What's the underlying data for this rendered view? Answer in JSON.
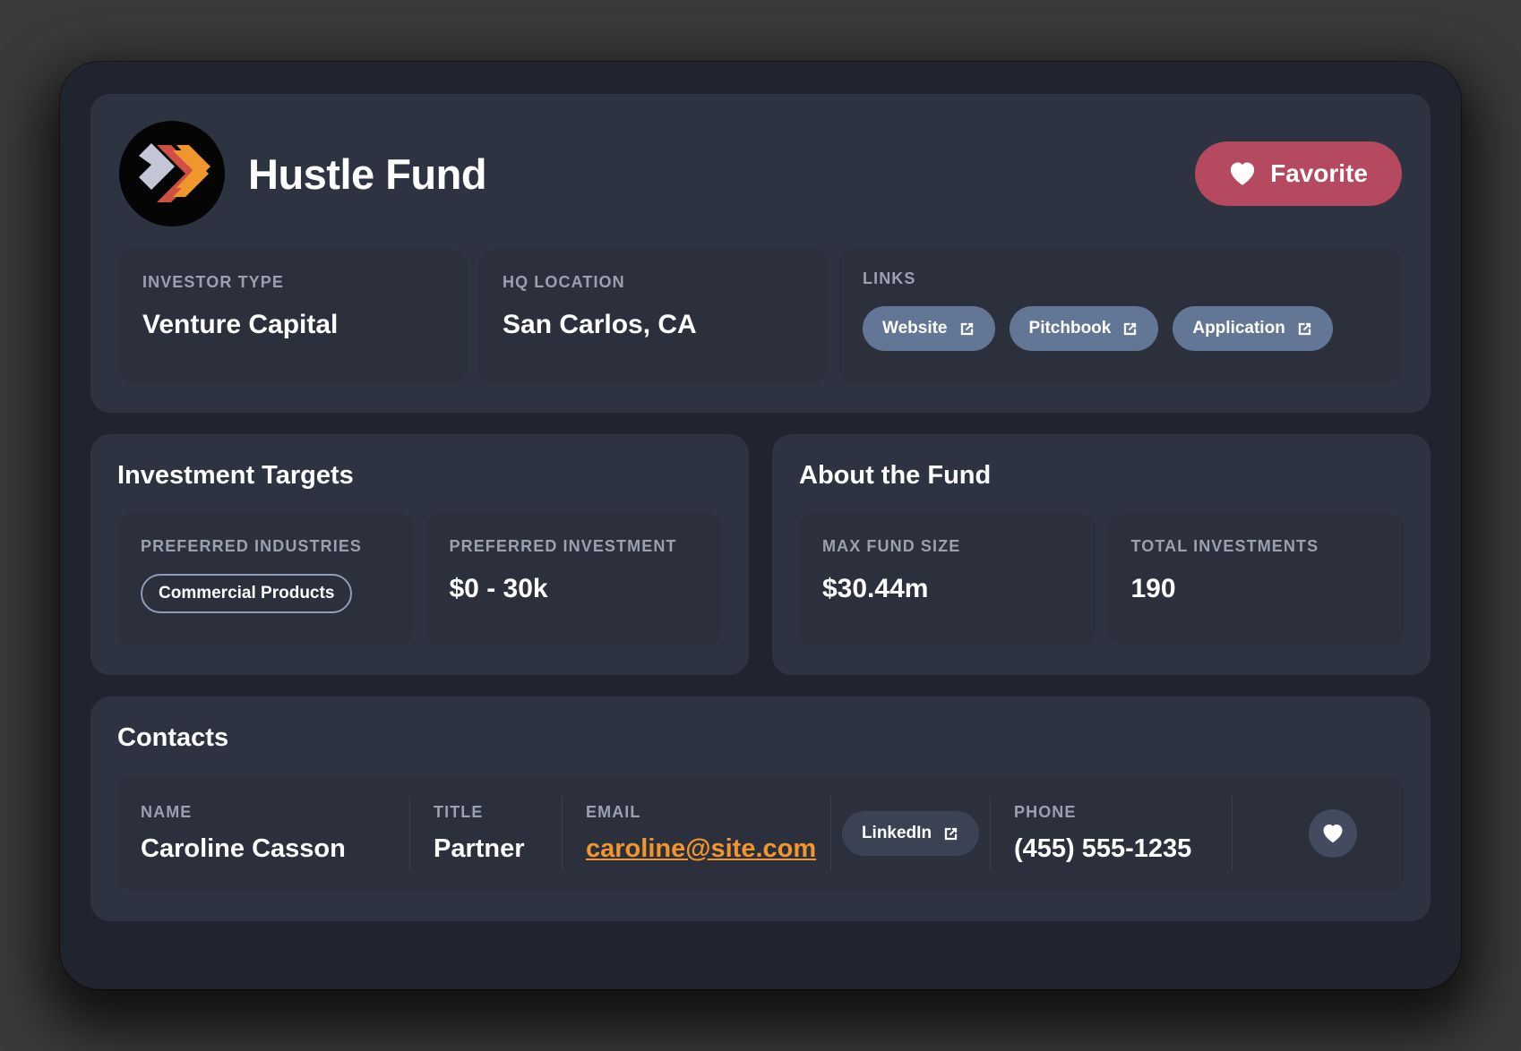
{
  "header": {
    "logo_icon": "hustle-fund-chevrons-logo",
    "fund_name": "Hustle Fund",
    "favorite_button": {
      "label": "Favorite",
      "icon": "heart-icon",
      "color": "#b4495f"
    },
    "tiles": [
      {
        "label": "INVESTOR TYPE",
        "value": "Venture Capital"
      },
      {
        "label": "HQ LOCATION",
        "value": "San Carlos, CA"
      }
    ],
    "links": {
      "label": "LINKS",
      "color": "#647695",
      "items": [
        {
          "label": "Website",
          "icon": "external-link-icon"
        },
        {
          "label": "Pitchbook",
          "icon": "external-link-icon"
        },
        {
          "label": "Application",
          "icon": "external-link-icon"
        }
      ]
    }
  },
  "investment_targets": {
    "title": "Investment Targets",
    "preferred_industries": {
      "label": "PREFERRED INDUSTRIES",
      "chips": [
        "Commercial Products"
      ]
    },
    "preferred_investment": {
      "label": "PREFERRED INVESTMENT",
      "value": "$0 - 30k"
    }
  },
  "about_the_fund": {
    "title": "About the Fund",
    "max_fund_size": {
      "label": "MAX FUND SIZE",
      "value": "$30.44m"
    },
    "total_investments": {
      "label": "TOTAL INVESTMENTS",
      "value": "190"
    }
  },
  "contacts": {
    "title": "Contacts",
    "columns": {
      "name": "NAME",
      "title": "TITLE",
      "email": "EMAIL",
      "phone": "PHONE"
    },
    "rows": [
      {
        "name": "Caroline Casson",
        "title": "Partner",
        "email": "caroline@site.com",
        "email_color": "#f0962e",
        "linkedin_label": "LinkedIn",
        "linkedin_icon": "external-link-icon",
        "phone": "(455) 555-1235",
        "favorite_icon": "heart-icon"
      }
    ]
  },
  "theme": {
    "window_bg": "#20242e",
    "card_bg": "#2e3342",
    "subcard_bg": "#2b303c",
    "label_color": "#9aa1b0",
    "accent_rose": "#b4495f",
    "accent_slate": "#647695",
    "accent_orange": "#f0962e"
  }
}
